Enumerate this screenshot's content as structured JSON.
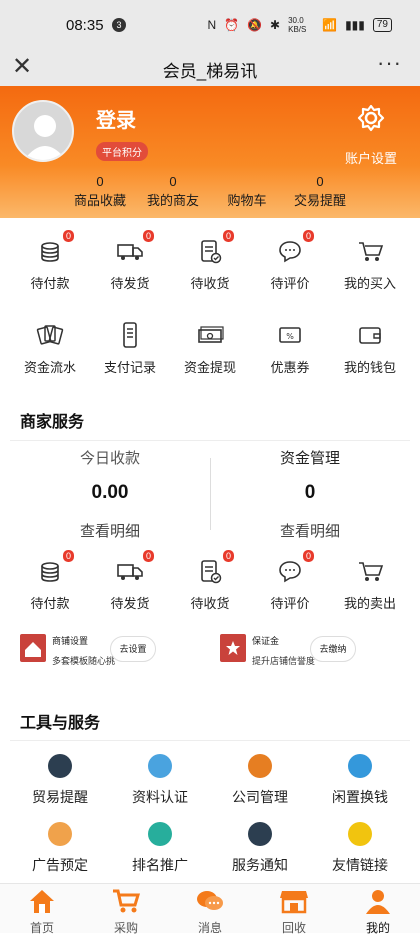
{
  "status_bar": {
    "time": "08:35",
    "dot_label": "3",
    "network": "30.0 KB/S",
    "battery": "79"
  },
  "title_bar": {
    "title": "会员_梯易讯"
  },
  "profile": {
    "login_label": "登录",
    "points_badge": "平台积分",
    "settings_label": "账户设置",
    "stats": [
      {
        "value": "0",
        "label": "商品收藏"
      },
      {
        "value": "0",
        "label": "我的商友"
      },
      {
        "value": "",
        "label": "购物车"
      },
      {
        "value": "0",
        "label": "交易提醒"
      }
    ]
  },
  "order_row": [
    {
      "label": "待付款",
      "count": "0"
    },
    {
      "label": "待发货",
      "count": "0"
    },
    {
      "label": "待收货",
      "count": "0"
    },
    {
      "label": "待评价",
      "count": "0"
    },
    {
      "label": "我的买入",
      "count": ""
    }
  ],
  "finance_row": [
    {
      "label": "资金流水"
    },
    {
      "label": "支付记录"
    },
    {
      "label": "资金提现"
    },
    {
      "label": "优惠券"
    },
    {
      "label": "我的钱包"
    }
  ],
  "merchant": {
    "title": "商家服务",
    "income": {
      "label": "今日收款",
      "value": "0.00",
      "link": "查看明细"
    },
    "funds": {
      "label": "资金管理",
      "value": "0",
      "link": "查看明细"
    },
    "sales_row": [
      {
        "label": "待付款",
        "count": "0"
      },
      {
        "label": "待发货",
        "count": "0"
      },
      {
        "label": "待收货",
        "count": "0"
      },
      {
        "label": "待评价",
        "count": "0"
      },
      {
        "label": "我的卖出",
        "count": ""
      }
    ],
    "promo_left": {
      "title": "商铺设置",
      "subtitle": "多套模板随心挑",
      "button": "去设置"
    },
    "promo_right": {
      "title": "保证金",
      "subtitle": "提升店铺信誉度",
      "button": "去缴纳"
    }
  },
  "tools": {
    "title": "工具与服务",
    "items": [
      {
        "label": "贸易提醒",
        "color": "#2c3e50"
      },
      {
        "label": "资料认证",
        "color": "#4aa3df"
      },
      {
        "label": "公司管理",
        "color": "#e67e22"
      },
      {
        "label": "闲置换钱",
        "color": "#3498db"
      },
      {
        "label": "广告预定",
        "color": "#f0a24b"
      },
      {
        "label": "排名推广",
        "color": "#27ae9c"
      },
      {
        "label": "服务通知",
        "color": "#2c3e50"
      },
      {
        "label": "友情链接",
        "color": "#f1c40f"
      }
    ]
  },
  "tabbar": [
    {
      "label": "首页",
      "active": false
    },
    {
      "label": "采购",
      "active": false
    },
    {
      "label": "消息",
      "active": false
    },
    {
      "label": "回收",
      "active": false
    },
    {
      "label": "我的",
      "active": true
    }
  ],
  "colors": {
    "accent": "#f47a1a",
    "badge_red": "#e83a2b"
  }
}
